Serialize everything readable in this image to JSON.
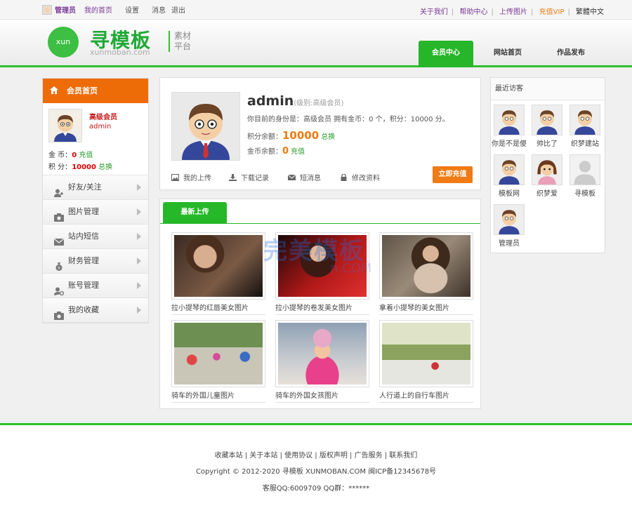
{
  "topbar": {
    "user": "管理员",
    "links": [
      "我的首页",
      "设置",
      "消息",
      "退出"
    ],
    "right": [
      "关于我们",
      "帮助中心",
      "上传图片",
      "充值VIP",
      "繁體中文"
    ]
  },
  "header": {
    "logo_circle": "xun",
    "logo_title": "寻模板",
    "logo_sub": "xunmoban.com",
    "logo_tag1": "素材",
    "logo_tag2": "平台",
    "nav": [
      "会员中心",
      "网站首页",
      "作品发布"
    ]
  },
  "sidebar": {
    "head": "会员首页",
    "level": "高级会员",
    "name": "admin",
    "gold_label": "金 币：",
    "gold_value": "0",
    "gold_action": "充值",
    "points_label": "积 分：",
    "points_value": "10000",
    "points_action": "总换",
    "items": [
      {
        "label": "好友/关注",
        "icon": "users-icon"
      },
      {
        "label": "图片管理",
        "icon": "image-icon"
      },
      {
        "label": "站内短信",
        "icon": "mail-icon"
      },
      {
        "label": "财务管理",
        "icon": "moneybag-icon"
      },
      {
        "label": "账号管理",
        "icon": "user-gear-icon"
      },
      {
        "label": "我的收藏",
        "icon": "camera-icon"
      }
    ]
  },
  "profile": {
    "username": "admin",
    "level": "(级别:高级会员)",
    "identity": "你目前的身份是：高级会员 拥有金币：0 个，积分：10000 分。",
    "points_label": "积分余额：",
    "points_value": "10000",
    "points_action": "总换",
    "gold_label": "金币余额：",
    "gold_value": "0",
    "gold_action": "充值",
    "actions": [
      "我的上传",
      "下载记录",
      "短消息",
      "修改资料"
    ],
    "recharge": "立即充值"
  },
  "uploads": {
    "tab": "最新上传",
    "photos": [
      {
        "caption": "拉小提琴的红唇美女图片",
        "colors": [
          "#3a2a22",
          "#c79a7c",
          "#151010"
        ]
      },
      {
        "caption": "拉小提琴的卷发美女图片",
        "colors": [
          "#7a0c0c",
          "#d02020",
          "#1a0808"
        ]
      },
      {
        "caption": "拿着小提琴的美女图片",
        "colors": [
          "#776655",
          "#d6c0aa",
          "#3d3229"
        ]
      },
      {
        "caption": "骑车的外国儿童图片",
        "colors": [
          "#9fb88a",
          "#d8d4c7",
          "#5a7a3e"
        ]
      },
      {
        "caption": "骑车的外国女孩图片",
        "colors": [
          "#8fa0b4",
          "#e84890",
          "#e6e0d8"
        ]
      },
      {
        "caption": "人行道上的自行车图片",
        "colors": [
          "#cfd6b0",
          "#8ba35e",
          "#eeeeea"
        ]
      }
    ],
    "watermark": "完美模板",
    "watermark2": "n.COM"
  },
  "visitors": {
    "title": "最近访客",
    "list": [
      "你是不是傻",
      "帅比了",
      "织梦建站",
      "模板网",
      "织梦爱",
      "寻模板",
      "管理员"
    ]
  },
  "footer": {
    "links": "收藏本站 | 关于本站 | 使用协议 | 版权声明 | 广告服务 | 联系我们",
    "copyright": "Copyright © 2012-2020 寻模板 XUNMOBAN.COM 闽ICP备12345678号",
    "contact": "客服QQ:6009709 QQ群：******"
  }
}
